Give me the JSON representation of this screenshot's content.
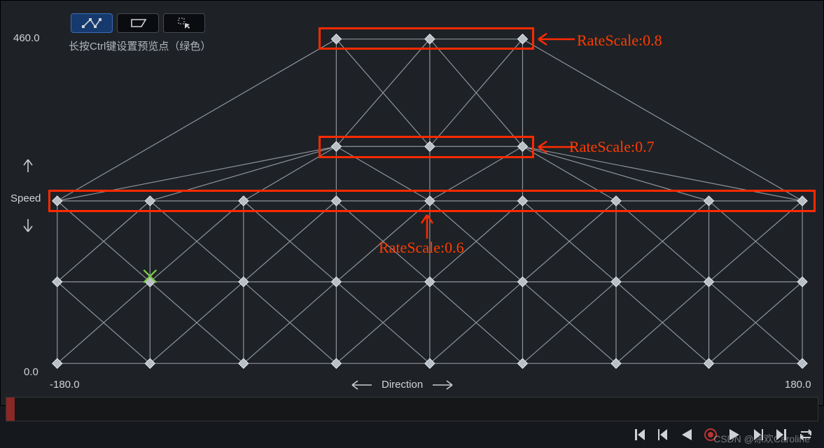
{
  "axes": {
    "y_label": "Speed",
    "y_max": "460.0",
    "y_min": "0.0",
    "x_label": "Direction",
    "x_min": "-180.0",
    "x_max": "180.0"
  },
  "hint": "长按Ctrl键设置预览点（绿色）",
  "toolbar": {
    "connect": "connect-icon",
    "box": "box-icon",
    "select": "select-icon"
  },
  "annotations": {
    "a1": "RateScale:0.8",
    "a2": "RateScale:0.7",
    "a3": "RateScale:0.6"
  },
  "watermark": "CSDN @涂欢Caroline",
  "chart_data": {
    "type": "scatter",
    "xlabel": "Direction",
    "ylabel": "Speed",
    "xlim": [
      -180,
      180
    ],
    "ylim": [
      0,
      460
    ],
    "rows": [
      {
        "speed": 0,
        "directions": [
          -180,
          -135,
          -90,
          -45,
          0,
          45,
          90,
          135,
          180
        ]
      },
      {
        "speed": 115,
        "directions": [
          -180,
          -135,
          -90,
          -45,
          0,
          45,
          90,
          135,
          180
        ],
        "preview": [
          -135
        ]
      },
      {
        "speed": 230,
        "directions": [
          -180,
          -135,
          -90,
          -45,
          0,
          45,
          90,
          135,
          180
        ],
        "rate_scale": 0.6
      },
      {
        "speed": 308,
        "directions": [
          -45,
          0,
          45
        ],
        "rate_scale": 0.7
      },
      {
        "speed": 460,
        "directions": [
          -45,
          0,
          45
        ],
        "rate_scale": 0.8
      }
    ]
  }
}
